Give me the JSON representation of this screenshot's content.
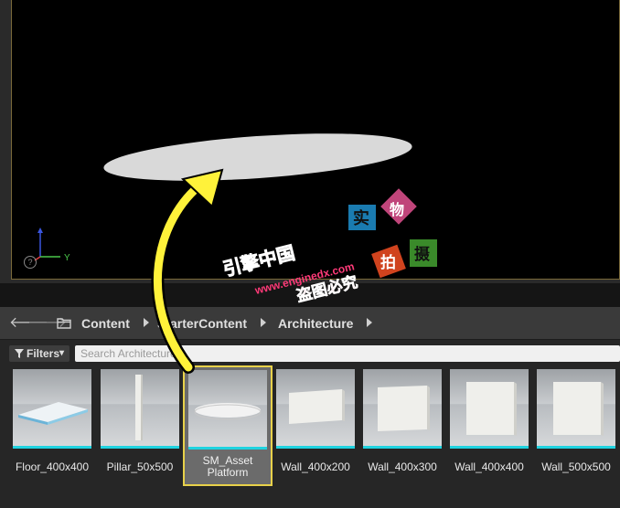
{
  "breadcrumb": {
    "items": [
      "Content",
      "StarterContent",
      "Architecture"
    ]
  },
  "filters": {
    "label": "Filters",
    "arrow": "▾"
  },
  "search": {
    "placeholder": "Search Architecture"
  },
  "assets": [
    {
      "name": "Floor_400x400"
    },
    {
      "name": "Pillar_50x500"
    },
    {
      "name": "SM_Asset\nPlatform",
      "line1": "SM_Asset",
      "line2": "Platform",
      "selected": true
    },
    {
      "name": "Wall_400x200"
    },
    {
      "name": "Wall_400x300"
    },
    {
      "name": "Wall_400x400"
    },
    {
      "name": "Wall_500x500"
    }
  ],
  "viewport": {
    "axis_y": "Y",
    "help": "?"
  },
  "watermark": {
    "brand": "引擎中国",
    "url": "www.enginedx.com",
    "warning": "盗图必究",
    "tags": [
      "实",
      "物",
      "拍",
      "摄"
    ]
  },
  "colors": {
    "selection_border": "#e8d14a",
    "asset_underline": "#1fd3e0",
    "arrow": "#fff23a",
    "watermark_text": "#ff3a78"
  }
}
